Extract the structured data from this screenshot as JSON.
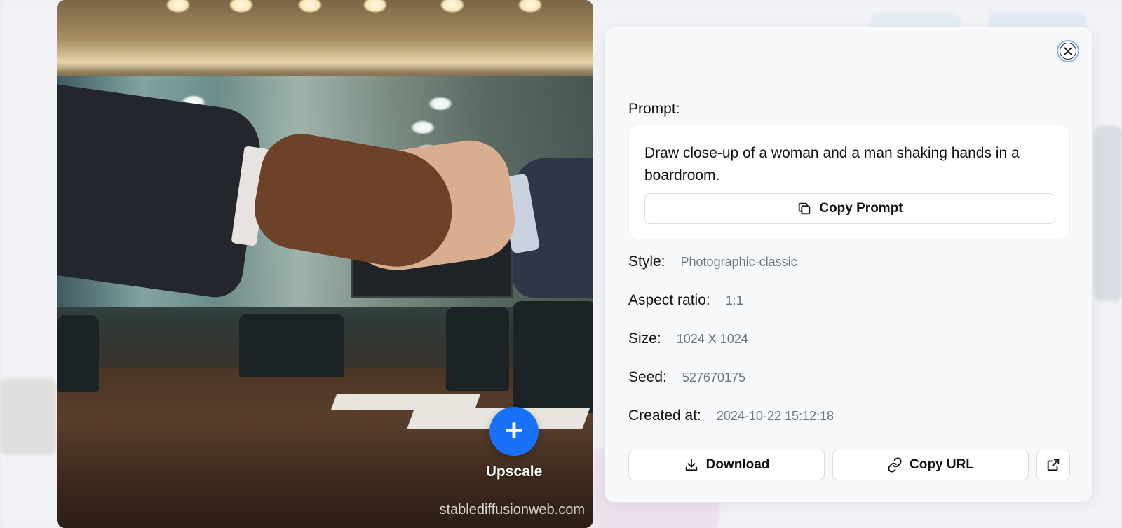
{
  "image": {
    "upscale_label": "Upscale",
    "watermark": "stablediffusionweb.com"
  },
  "details": {
    "prompt_title": "Prompt:",
    "prompt_text": "Draw close-up of a woman and a man shaking hands in a boardroom.",
    "copy_prompt_label": "Copy Prompt",
    "fields": [
      {
        "label": "Style:",
        "value": "Photographic-classic"
      },
      {
        "label": "Aspect ratio:",
        "value": "1:1"
      },
      {
        "label": "Size:",
        "value": "1024 X 1024"
      },
      {
        "label": "Seed:",
        "value": "527670175"
      },
      {
        "label": "Created at:",
        "value": "2024-10-22 15:12:18"
      }
    ],
    "download_label": "Download",
    "copy_url_label": "Copy URL"
  },
  "icons": {
    "close": "close-icon",
    "copy": "copy-icon",
    "download": "download-icon",
    "link": "link-icon",
    "external": "external-link-icon",
    "plus": "plus-icon"
  },
  "colors": {
    "accent": "#1971f7",
    "panel_bg": "#f7f8fa",
    "muted_text": "#6b7280"
  }
}
